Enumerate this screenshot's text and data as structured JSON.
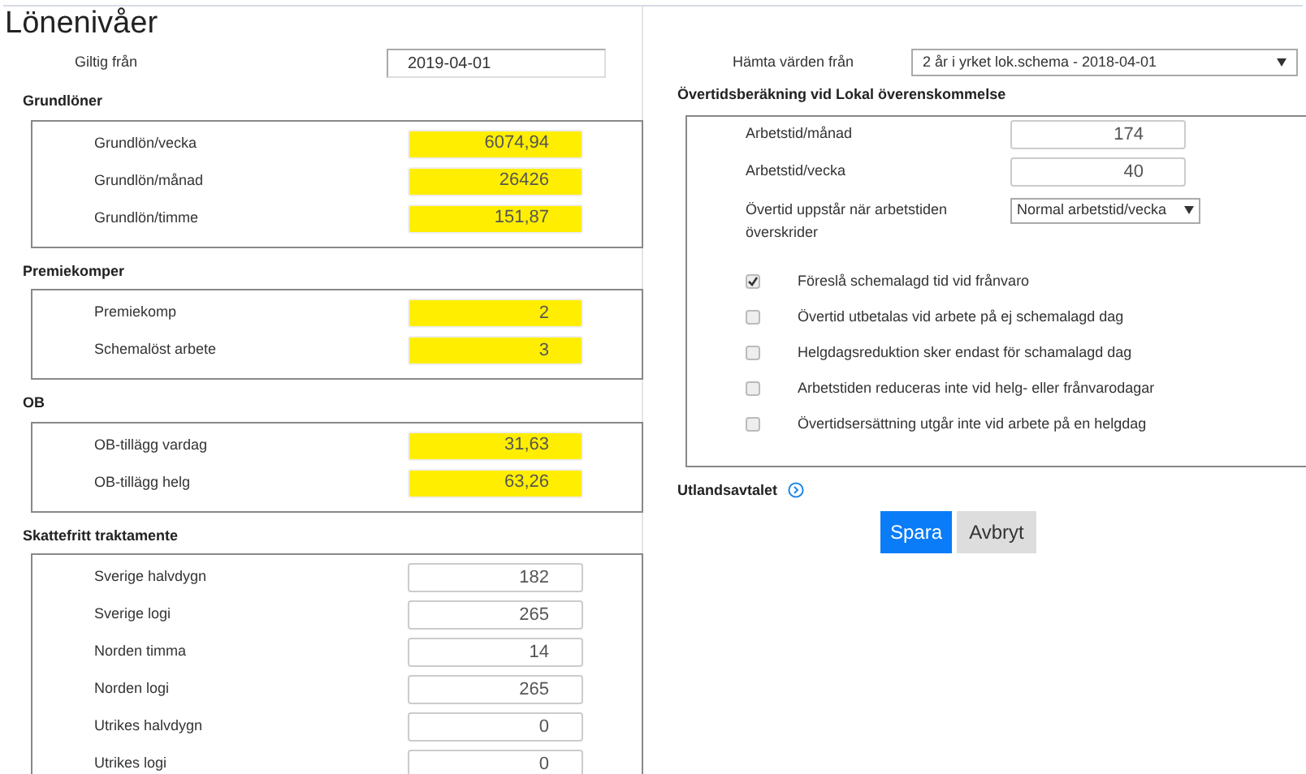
{
  "title": "Lönenivåer",
  "valid_from": {
    "label": "Giltig från",
    "value": "2019-04-01"
  },
  "left_sections": [
    {
      "heading": "Grundlöner",
      "fields": [
        {
          "label": "Grundlön/vecka",
          "value": "6074,94",
          "highlighted": true
        },
        {
          "label": "Grundlön/månad",
          "value": "26426",
          "highlighted": true
        },
        {
          "label": "Grundlön/timme",
          "value": "151,87",
          "highlighted": true
        }
      ]
    },
    {
      "heading": "Premiekomper",
      "fields": [
        {
          "label": "Premiekomp",
          "value": "2",
          "highlighted": true
        },
        {
          "label": "Schemalöst arbete",
          "value": "3",
          "highlighted": true
        }
      ]
    },
    {
      "heading": "OB",
      "fields": [
        {
          "label": "OB-tillägg vardag",
          "value": "31,63",
          "highlighted": true
        },
        {
          "label": "OB-tillägg helg",
          "value": "63,26",
          "highlighted": true
        }
      ]
    },
    {
      "heading": "Skattefritt traktamente",
      "fields": [
        {
          "label": "Sverige halvdygn",
          "value": "182",
          "highlighted": false
        },
        {
          "label": "Sverige logi",
          "value": "265",
          "highlighted": false
        },
        {
          "label": "Norden timma",
          "value": "14",
          "highlighted": false
        },
        {
          "label": "Norden logi",
          "value": "265",
          "highlighted": false
        },
        {
          "label": "Utrikes halvdygn",
          "value": "0",
          "highlighted": false
        },
        {
          "label": "Utrikes logi",
          "value": "0",
          "highlighted": false
        }
      ]
    }
  ],
  "fetch_from": {
    "label": "Hämta värden från",
    "value": "2 år i yrket lok.schema - 2018-04-01"
  },
  "overtime": {
    "heading": "Övertidsberäkning vid Lokal överenskommelse",
    "fields": [
      {
        "label": "Arbetstid/månad",
        "value": "174"
      },
      {
        "label": "Arbetstid/vecka",
        "value": "40"
      }
    ],
    "trigger": {
      "label": "Övertid uppstår när arbetstiden överskrider",
      "value": "Normal arbetstid/vecka"
    },
    "options": [
      {
        "label": "Föreslå schemalagd tid vid frånvaro",
        "checked": true
      },
      {
        "label": "Övertid utbetalas vid arbete på ej schemalagd dag",
        "checked": false
      },
      {
        "label": "Helgdagsreduktion sker endast för schamalagd dag",
        "checked": false
      },
      {
        "label": "Arbetstiden reduceras inte vid helg- eller frånvarodagar",
        "checked": false
      },
      {
        "label": "Övertidsersättning utgår inte vid arbete på en helgdag",
        "checked": false
      }
    ]
  },
  "foreign": {
    "label": "Utlandsavtalet"
  },
  "buttons": [
    {
      "label": "Spara",
      "kind": "primary"
    },
    {
      "label": "Avbryt",
      "kind": "secondary"
    }
  ]
}
